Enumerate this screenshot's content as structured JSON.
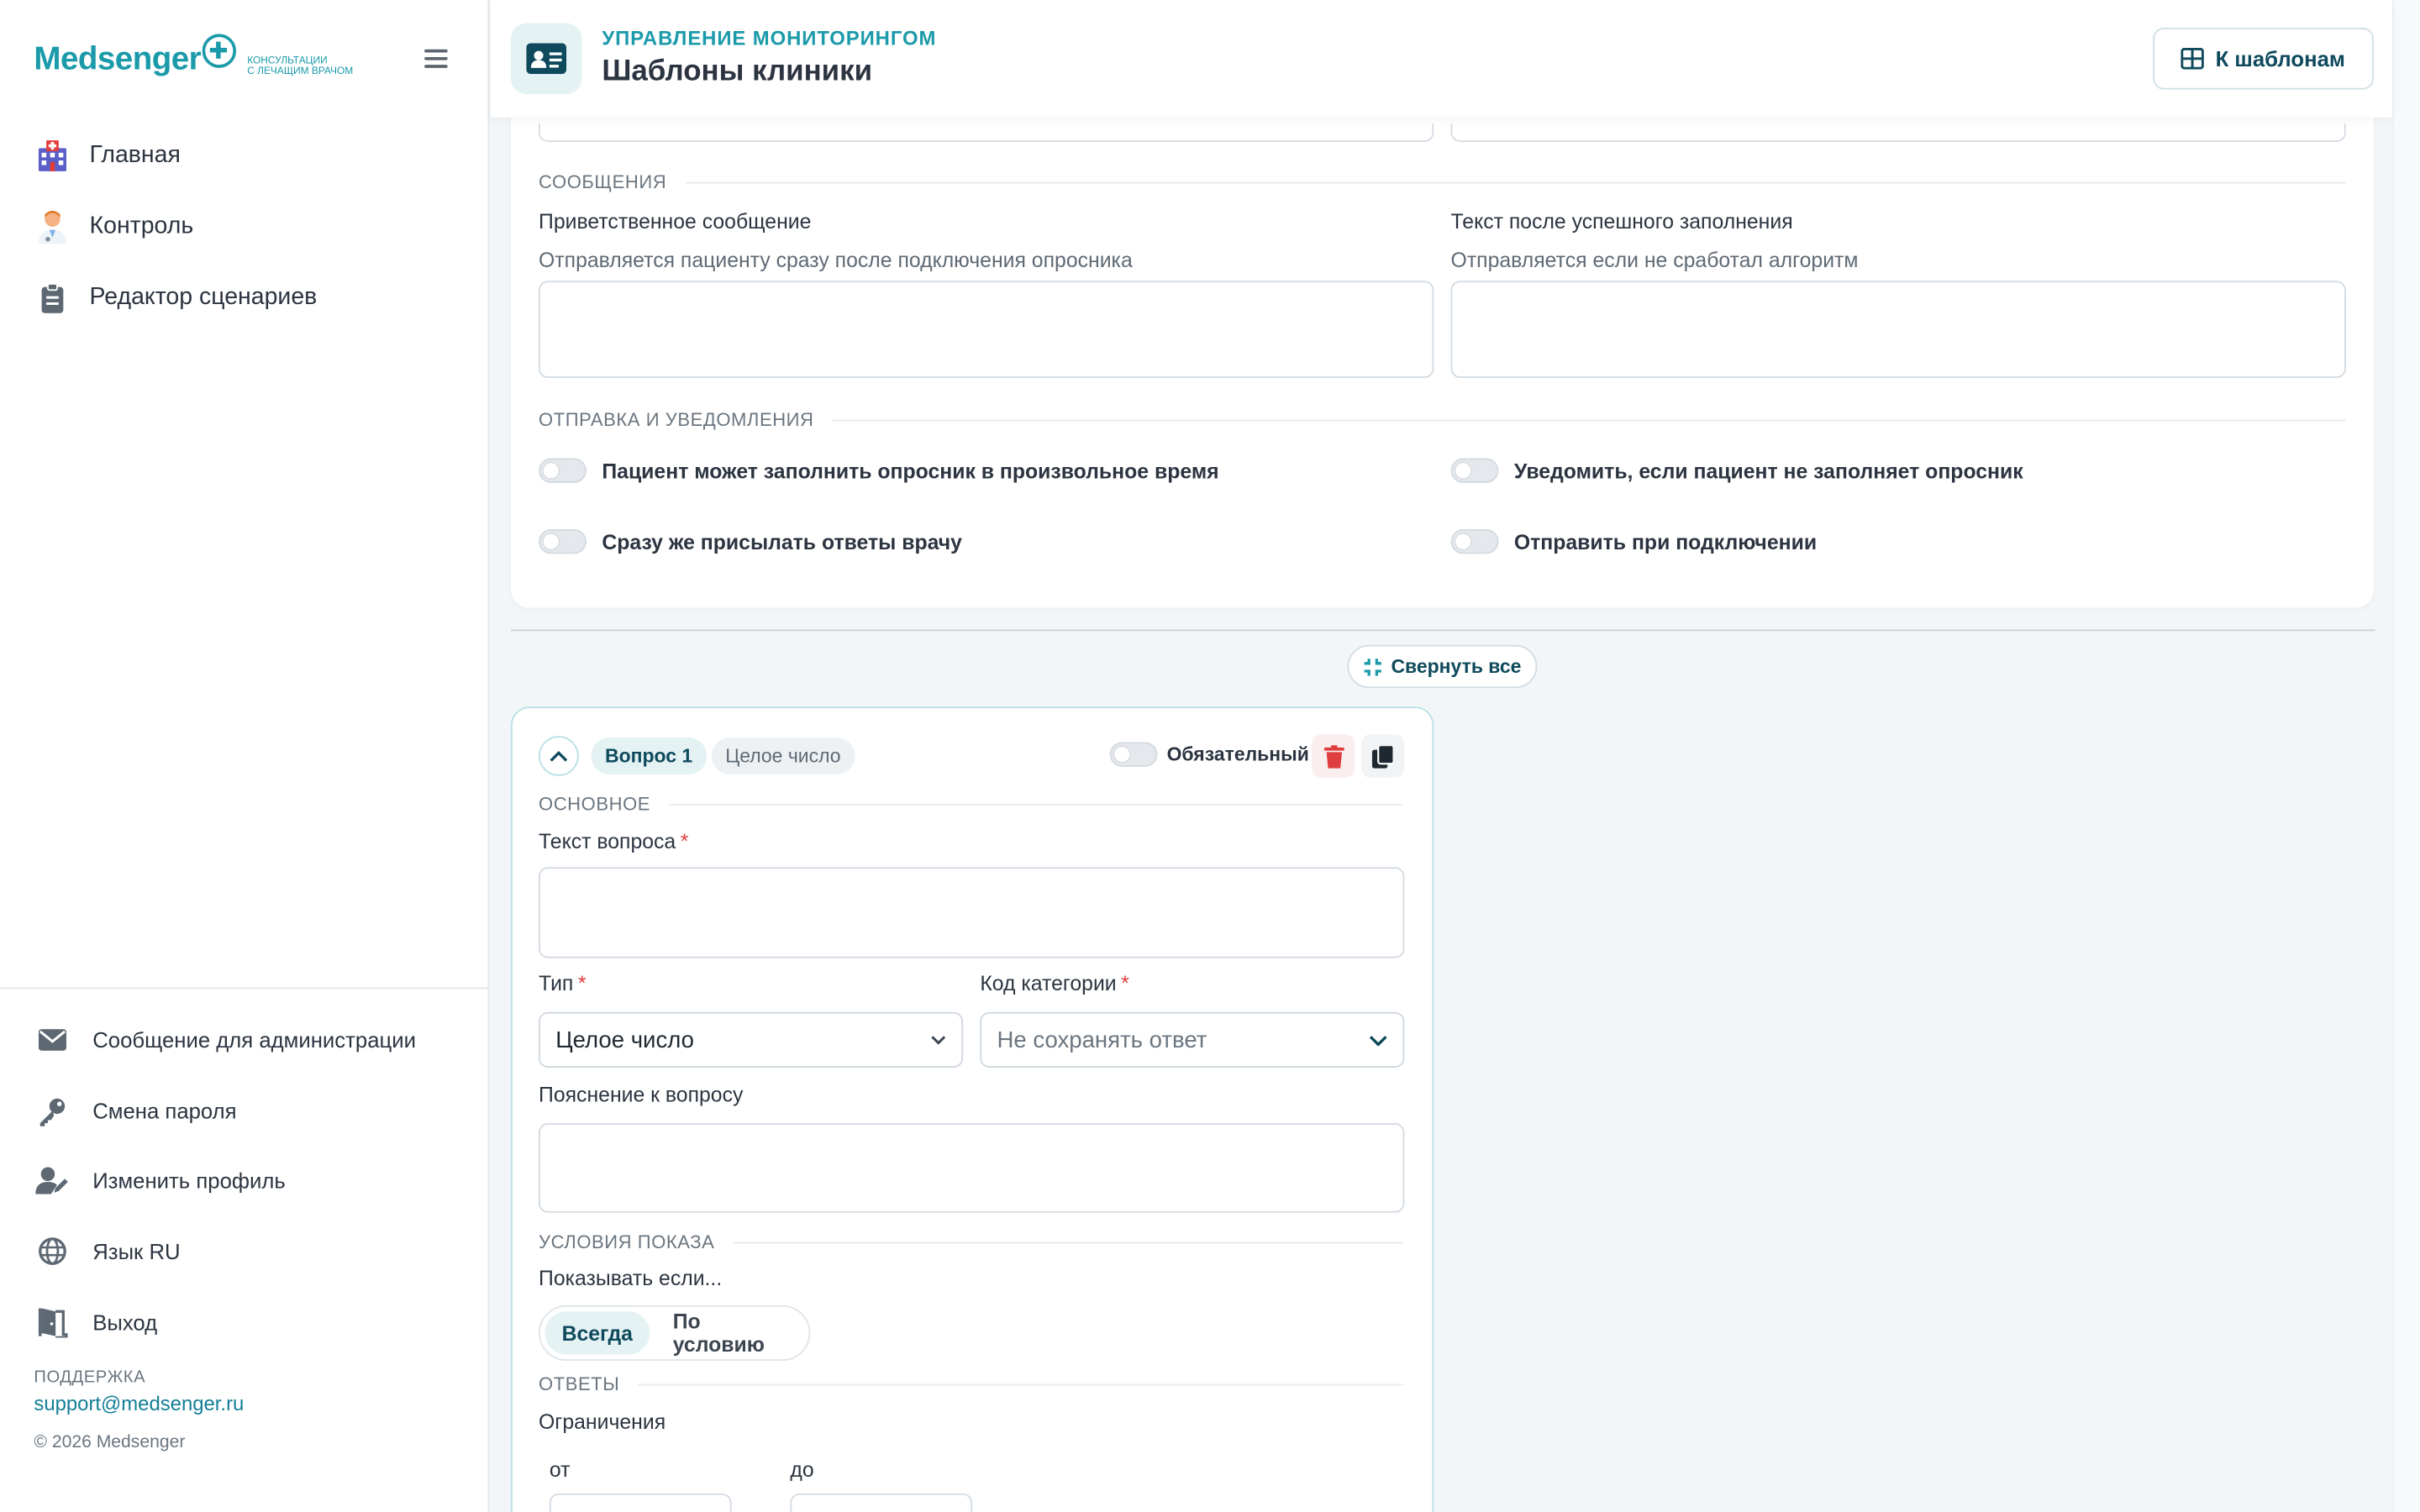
{
  "sidebar": {
    "logo_word": "Medsenger",
    "logo_sub_1": "консультации",
    "logo_sub_2": "с лечащим врачом",
    "nav": [
      {
        "label": "Главная",
        "icon": "hospital-icon"
      },
      {
        "label": "Контроль",
        "icon": "doctor-icon"
      },
      {
        "label": "Редактор сценариев",
        "icon": "clipboard-icon"
      }
    ],
    "bottom": [
      {
        "label": "Сообщение для администрации",
        "icon": "envelope-icon"
      },
      {
        "label": "Смена пароля",
        "icon": "key-icon"
      },
      {
        "label": "Изменить профиль",
        "icon": "user-edit-icon"
      },
      {
        "label": "Язык RU",
        "icon": "globe-icon"
      },
      {
        "label": "Выход",
        "icon": "exit-door-icon"
      }
    ],
    "support_title": "ПОДДЕРЖКА",
    "support_email": "support@medsenger.ru",
    "copyright": "© 2026 Medsenger"
  },
  "header": {
    "kicker": "УПРАВЛЕНИЕ МОНИТОРИНГОМ",
    "title": "Шаблоны клиники",
    "back_button": "К шаблонам"
  },
  "messages": {
    "section": "СООБЩЕНИЯ",
    "welcome_label": "Приветственное сообщение",
    "welcome_hint": "Отправляется пациенту сразу после подключения опросника",
    "welcome_value": "",
    "success_label": "Текст после успешного заполнения",
    "success_hint": "Отправляется если не сработал алгоритм",
    "success_value": ""
  },
  "notifications": {
    "section": "ОТПРАВКА И УВЕДОМЛЕНИЯ",
    "any_time": "Пациент может заполнить опросник в произвольное время",
    "notify_missed": "Уведомить, если пациент не заполняет опросник",
    "send_answers": "Сразу же присылать ответы врачу",
    "send_on_connect": "Отправить при подключении",
    "toggles_on": [
      false,
      false,
      false,
      false
    ]
  },
  "collapse_all": "Свернуть все",
  "question": {
    "number_label": "Вопрос 1",
    "type_badge": "Целое число",
    "required_label": "Обязательный",
    "required_on": false,
    "section_main": "ОСНОВНОЕ",
    "text_label": "Текст вопроса",
    "text_value": "",
    "type_label": "Тип",
    "type_value": "Целое число",
    "category_label": "Код категории",
    "category_placeholder": "Не сохранять ответ",
    "explanation_label": "Пояснение к вопросу",
    "explanation_value": "",
    "section_conditions": "УСЛОВИЯ ПОКАЗА",
    "show_if": "Показывать если...",
    "show_options": [
      "Всегда",
      "По условию"
    ],
    "show_selected": "Всегда",
    "section_answers": "ОТВЕТЫ",
    "limits_label": "Ограничения",
    "from_label": "от",
    "to_label": "до",
    "from_value": "",
    "to_value": ""
  },
  "colors": {
    "accent": "#1b9aaa",
    "dark_accent": "#0e4a5c",
    "danger": "#e03e3e",
    "background": "#f3f6f8"
  }
}
